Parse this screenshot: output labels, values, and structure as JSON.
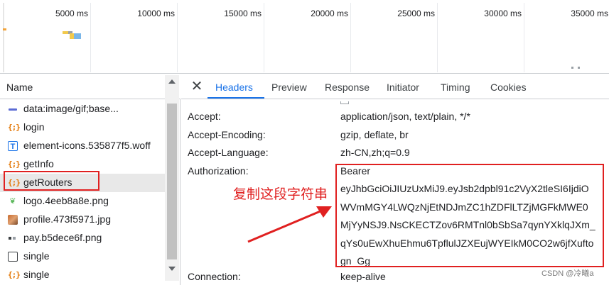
{
  "timeline": {
    "ticks": [
      "5000 ms",
      "10000 ms",
      "15000 ms",
      "20000 ms",
      "25000 ms",
      "30000 ms",
      "35000 ms"
    ]
  },
  "name_column": {
    "header": "Name",
    "rows": [
      {
        "name": "data:image/gif;base...",
        "icon": "image-dash-icon"
      },
      {
        "name": "login",
        "icon": "xhr-braces-icon"
      },
      {
        "name": "element-icons.535877f5.woff",
        "icon": "font-icon"
      },
      {
        "name": "getInfo",
        "icon": "xhr-braces-icon"
      },
      {
        "name": "getRouters",
        "icon": "xhr-braces-icon",
        "selected": true
      },
      {
        "name": "logo.4eeb8a8e.png",
        "icon": "leaf-image-icon"
      },
      {
        "name": "profile.473f5971.jpg",
        "icon": "photo-thumbnail-icon"
      },
      {
        "name": "pay.b5dece6f.png",
        "icon": "png-image-icon"
      },
      {
        "name": "single",
        "icon": "document-icon"
      },
      {
        "name": "single",
        "icon": "xhr-braces-icon"
      }
    ]
  },
  "detail": {
    "close_icon": "close-icon",
    "tabs": [
      "Headers",
      "Preview",
      "Response",
      "Initiator",
      "Timing",
      "Cookies"
    ],
    "active_tab": "Headers",
    "headers": [
      {
        "name": "Accept:",
        "value": "application/json, text/plain, */*"
      },
      {
        "name": "Accept-Encoding:",
        "value": "gzip, deflate, br"
      },
      {
        "name": "Accept-Language:",
        "value": "zh-CN,zh;q=0.9"
      },
      {
        "name": "Authorization:",
        "value": "Bearer"
      },
      {
        "name": "Connection:",
        "value": "keep-alive"
      }
    ],
    "authorization_lines": [
      "Bearer",
      "eyJhbGciOiJIUzUxMiJ9.eyJsb2dpbl91c2VyX2tleSI6IjdiO",
      "WVmMGY4LWQzNjEtNDJmZC1hZDFlLTZjMGFkMWE0",
      "MjYyNSJ9.NsCKECTZov6RMTnl0bSbSa7qynYXklqJXm_",
      "qYs0uEwXhuEhmu6TpflulJZXEujWYEIkM0CO2w6jfXufto",
      "gn_Gg"
    ]
  },
  "annotation": {
    "text": "复制这段字符串",
    "color": "#e02020"
  },
  "watermark": "CSDN @冷曦a",
  "colors": {
    "accent": "#1a73e8",
    "highlight_red": "#e02020",
    "xhr_orange": "#e37400"
  }
}
